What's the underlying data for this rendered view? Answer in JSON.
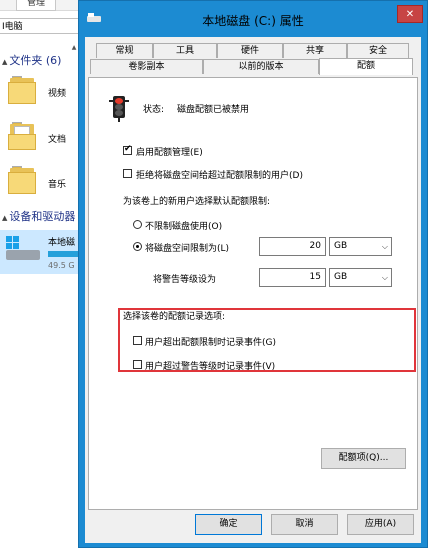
{
  "explorer": {
    "ribbon_tab": "管理",
    "address": "I电脑",
    "folders_header": "文件夹 (6)",
    "folders": [
      {
        "label": "视频",
        "icon": "folder-video-icon"
      },
      {
        "label": "文档",
        "icon": "folder-documents-icon"
      },
      {
        "label": "音乐",
        "icon": "folder-music-icon"
      }
    ],
    "devices_header": "设备和驱动器",
    "drive": {
      "name": "本地磁",
      "free": "49.5 G",
      "icon": "local-disk-icon"
    }
  },
  "dialog": {
    "title": "本地磁盘 (C:) 属性",
    "close_label": "✕",
    "tabs_row1": [
      "常规",
      "工具",
      "硬件",
      "共享",
      "安全"
    ],
    "tabs_row2": [
      "卷影副本",
      "以前的版本",
      "配额"
    ],
    "active_tab": "配额",
    "status_label": "状态:",
    "status_value": "磁盘配额已被禁用",
    "enable_quota_label": "启用配额管理(E)",
    "enable_quota_checked": true,
    "deny_space_label": "拒绝将磁盘空间给超过配额限制的用户(D)",
    "deny_space_checked": false,
    "default_limit_heading": "为该卷上的新用户选择默认配额限制:",
    "no_limit_label": "不限制磁盘使用(O)",
    "limit_label": "将磁盘空间限制为(L)",
    "selected_option": "limit",
    "limit_value": "20",
    "limit_unit": "GB",
    "warning_label": "将警告等级设为",
    "warning_value": "15",
    "warning_unit": "GB",
    "log_heading": "选择该卷的配额记录选项:",
    "log_exceed_label": "用户超出配额限制时记录事件(G)",
    "log_warning_label": "用户超过警告等级时记录事件(V)",
    "quota_entries_button": "配额项(Q)...",
    "ok_button": "确定",
    "cancel_button": "取消",
    "apply_button": "应用(A)",
    "colors": {
      "titlebar": "#1c8bd2",
      "highlight": "#e0353a",
      "close": "#c74444"
    }
  }
}
